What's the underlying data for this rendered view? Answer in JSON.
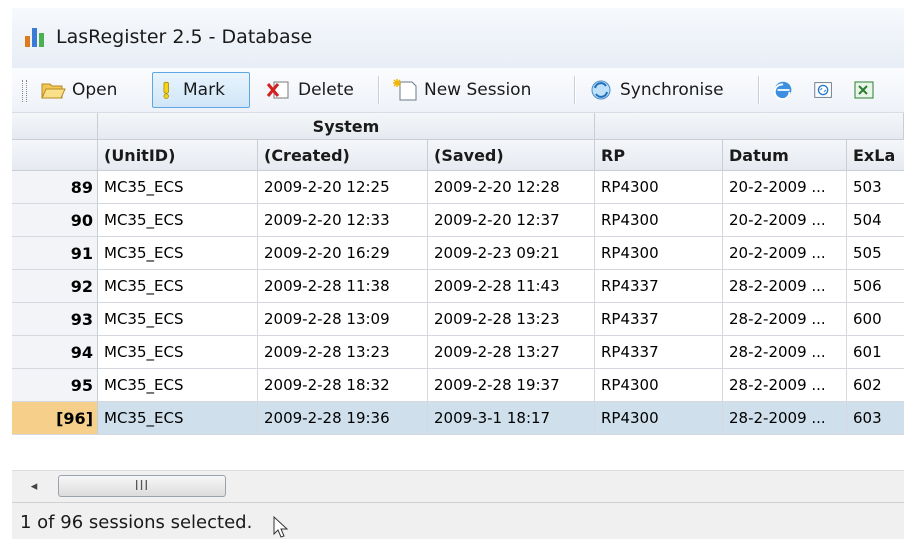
{
  "window": {
    "title": "LasRegister 2.5 - Database",
    "icon": "bar-chart-app-icon"
  },
  "toolbar": {
    "open_label": "Open",
    "mark_label": "Mark",
    "delete_label": "Delete",
    "new_session_label": "New Session",
    "synchronise_label": "Synchronise",
    "icons": [
      "folder-open-icon",
      "exclamation-mark-icon",
      "delete-icon",
      "new-session-icon",
      "synchronise-icon",
      "browser-icon",
      "xml-export-icon",
      "excel-export-icon"
    ]
  },
  "grid": {
    "group_header": "System",
    "columns": [
      "(UnitID)",
      "(Created)",
      "(Saved)",
      "RP",
      "Datum",
      "ExLa"
    ],
    "rows": [
      {
        "num": "89",
        "cells": [
          "MC35_ECS",
          "2009-2-20 12:25",
          "2009-2-20 12:28",
          "RP4300",
          "20-2-2009 ...",
          "503"
        ]
      },
      {
        "num": "90",
        "cells": [
          "MC35_ECS",
          "2009-2-20 12:33",
          "2009-2-20 12:37",
          "RP4300",
          "20-2-2009 ...",
          "504"
        ]
      },
      {
        "num": "91",
        "cells": [
          "MC35_ECS",
          "2009-2-20 16:29",
          "2009-2-23 09:21",
          "RP4300",
          "20-2-2009 ...",
          "505"
        ]
      },
      {
        "num": "92",
        "cells": [
          "MC35_ECS",
          "2009-2-28 11:38",
          "2009-2-28 11:43",
          "RP4337",
          "28-2-2009 ...",
          "506"
        ]
      },
      {
        "num": "93",
        "cells": [
          "MC35_ECS",
          "2009-2-28 13:09",
          "2009-2-28 13:23",
          "RP4337",
          "28-2-2009 ...",
          "600"
        ]
      },
      {
        "num": "94",
        "cells": [
          "MC35_ECS",
          "2009-2-28 13:23",
          "2009-2-28 13:27",
          "RP4337",
          "28-2-2009 ...",
          "601"
        ]
      },
      {
        "num": "95",
        "cells": [
          "MC35_ECS",
          "2009-2-28 18:32",
          "2009-2-28 19:37",
          "RP4300",
          "28-2-2009 ...",
          "602"
        ]
      },
      {
        "num": "[96]",
        "cells": [
          "MC35_ECS",
          "2009-2-28 19:36",
          "2009-3-1 18:17",
          "RP4300",
          "28-2-2009 ...",
          "603"
        ],
        "selected": true
      }
    ]
  },
  "scrollbar": {
    "left_arrow": "◂",
    "thumb_grip": "III"
  },
  "status": {
    "text": "1 of 96 sessions selected."
  },
  "colors": {
    "selected_row": "#cfe0ec",
    "current_row_header": "#f6cf8a",
    "active_button_border": "#5ea7e0"
  }
}
